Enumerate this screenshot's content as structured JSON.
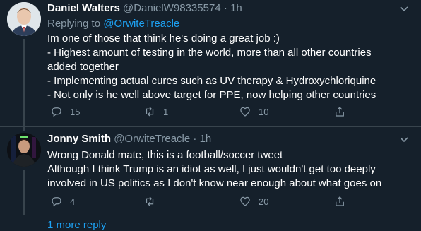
{
  "tweet1": {
    "name": "Daniel Walters",
    "handle": "@DanielW98335574",
    "dot": "·",
    "time": "1h",
    "reply_prefix": "Replying to",
    "reply_handle": "@OrwiteTreacle",
    "lines": [
      "Im one of those that think he's doing a great job :)",
      "- Highest amount of testing in the world, more than all other countries",
      "added together",
      "- Implementing actual cures such as UV therapy & Hydroxychloriquine",
      "- Not only is he well above target for PPE, now helping other countries"
    ],
    "replies": "15",
    "retweets": "1",
    "likes": "10"
  },
  "tweet2": {
    "name": "Jonny Smith",
    "handle": "@OrwiteTreacle",
    "dot": "·",
    "time": "1h",
    "lines": [
      "Wrong Donald mate, this is a football/soccer tweet",
      "Although I think Trump is an idiot as well, I just wouldn't get too deeply",
      "involved in US politics as I don't know near enough about what goes on"
    ],
    "replies": "4",
    "retweets": "",
    "likes": "20"
  },
  "more_replies": "1 more reply",
  "icons": {
    "reply": "reply-icon",
    "retweet": "retweet-icon",
    "like": "heart-icon",
    "share": "share-icon",
    "menu": "chevron-down-icon"
  },
  "colors": {
    "background": "#15202b",
    "link": "#1da1f2",
    "muted": "#8899a6",
    "divider": "#38444d"
  }
}
